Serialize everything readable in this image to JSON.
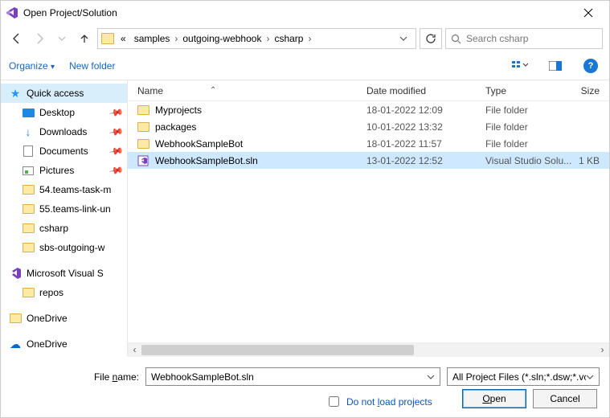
{
  "window": {
    "title": "Open Project/Solution"
  },
  "breadcrumb": {
    "segments": [
      "samples",
      "outgoing-webhook",
      "csharp"
    ]
  },
  "search": {
    "placeholder": "Search csharp"
  },
  "toolbar": {
    "organize": "Organize",
    "new_folder": "New folder"
  },
  "columns": {
    "name": "Name",
    "date": "Date modified",
    "type": "Type",
    "size": "Size"
  },
  "sidebar": {
    "items": [
      {
        "label": "Quick access",
        "icon": "star",
        "selected": true
      },
      {
        "label": "Desktop",
        "icon": "desktop",
        "indent": 1,
        "pinned": true
      },
      {
        "label": "Downloads",
        "icon": "download",
        "indent": 1,
        "pinned": true
      },
      {
        "label": "Documents",
        "icon": "doc",
        "indent": 1,
        "pinned": true
      },
      {
        "label": "Pictures",
        "icon": "pic",
        "indent": 1,
        "pinned": true
      },
      {
        "label": "54.teams-task-m",
        "icon": "folder",
        "indent": 1
      },
      {
        "label": "55.teams-link-un",
        "icon": "folder",
        "indent": 1
      },
      {
        "label": "csharp",
        "icon": "folder",
        "indent": 1
      },
      {
        "label": "sbs-outgoing-w",
        "icon": "folder",
        "indent": 1
      },
      {
        "label": "Microsoft Visual S",
        "icon": "vs",
        "indent": 0,
        "spacer_before": true
      },
      {
        "label": "repos",
        "icon": "folder",
        "indent": 1
      },
      {
        "label": "OneDrive",
        "icon": "folder",
        "indent": 0,
        "spacer_before": true
      },
      {
        "label": "OneDrive",
        "icon": "cloud",
        "indent": 0,
        "spacer_before": true
      }
    ]
  },
  "files": {
    "rows": [
      {
        "name": "Myprojects",
        "date": "18-01-2022 12:09",
        "type": "File folder",
        "size": "",
        "icon": "folder"
      },
      {
        "name": "packages",
        "date": "10-01-2022 13:32",
        "type": "File folder",
        "size": "",
        "icon": "folder"
      },
      {
        "name": "WebhookSampleBot",
        "date": "18-01-2022 11:57",
        "type": "File folder",
        "size": "",
        "icon": "folder"
      },
      {
        "name": "WebhookSampleBot.sln",
        "date": "13-01-2022 12:52",
        "type": "Visual Studio Solu...",
        "size": "1 KB",
        "icon": "sln",
        "selected": true
      }
    ]
  },
  "bottom": {
    "file_name_label": "File name:",
    "file_name_value": "WebhookSampleBot.sln",
    "filter": "All Project Files (*.sln;*.dsw;*.vc",
    "checkbox": "Do not load projects",
    "open": "Open",
    "cancel": "Cancel"
  }
}
